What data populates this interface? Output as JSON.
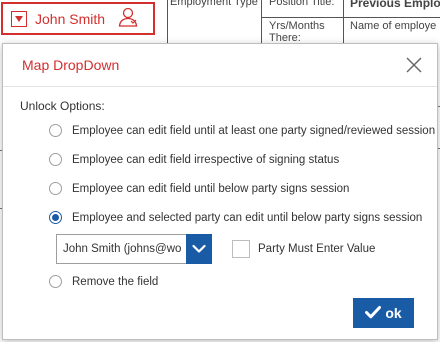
{
  "background": {
    "col1_header": "Employment Type:",
    "col2_header": "Position Title:",
    "col3_header": "Previous Employ",
    "col2_row2": "Yrs/Months",
    "col2_row3": "There:",
    "col3_row2": "Name of employe"
  },
  "signer_tag": {
    "name": "John Smith",
    "color": "#d32f2f"
  },
  "modal": {
    "title": "Map DropDown",
    "section_label": "Unlock Options:",
    "options": [
      {
        "label": "Employee can edit field until at least one party signed/reviewed session",
        "checked": false
      },
      {
        "label": "Employee can edit field irrespective of signing status",
        "checked": false
      },
      {
        "label": "Employee can edit field until below party signs session",
        "checked": false
      },
      {
        "label": "Employee and selected party can edit until below party signs session",
        "checked": true
      },
      {
        "label": "Remove the field",
        "checked": false
      }
    ],
    "party_select": {
      "value": "John Smith (johns@wo"
    },
    "party_must_enter": {
      "label": "Party Must Enter Value",
      "checked": false
    },
    "ok_label": "ok",
    "accent_color": "#1a5ba6"
  }
}
